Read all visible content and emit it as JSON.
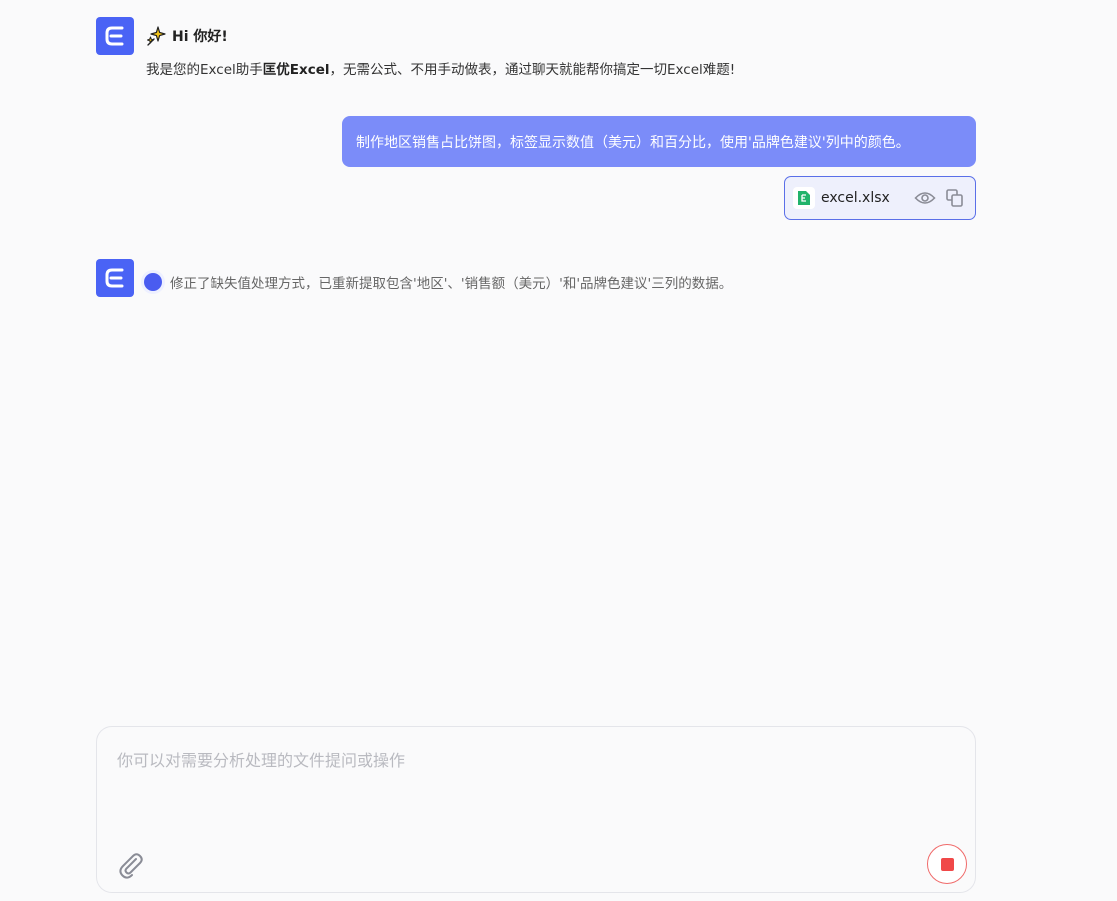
{
  "greeting": {
    "title": "Hi 你好!",
    "body_prefix": "我是您的Excel助手",
    "brand": "匡优Excel",
    "body_suffix": "，无需公式、不用手动做表，通过聊天就能帮你搞定一切Excel难题!"
  },
  "user_message": {
    "text": "制作地区销售占比饼图，标签显示数值（美元）和百分比，使用'品牌色建议'列中的颜色。"
  },
  "attachment": {
    "file_name": "excel.xlsx"
  },
  "status": {
    "text": "修正了缺失值处理方式，已重新提取包含'地区'、'销售额（美元）'和'品牌色建议'三列的数据。"
  },
  "composer": {
    "placeholder": "你可以对需要分析处理的文件提问或操作"
  },
  "colors": {
    "accent": "#4a63f5",
    "user_bubble": "#7b8cf9",
    "stop": "#f04848"
  },
  "icons": {
    "avatar": "excel-logo-icon",
    "sparkle": "sparkle-icon",
    "file": "excel-file-icon",
    "preview": "eye-icon",
    "copy": "copy-icon",
    "attach": "paperclip-icon",
    "stop": "stop-icon"
  }
}
